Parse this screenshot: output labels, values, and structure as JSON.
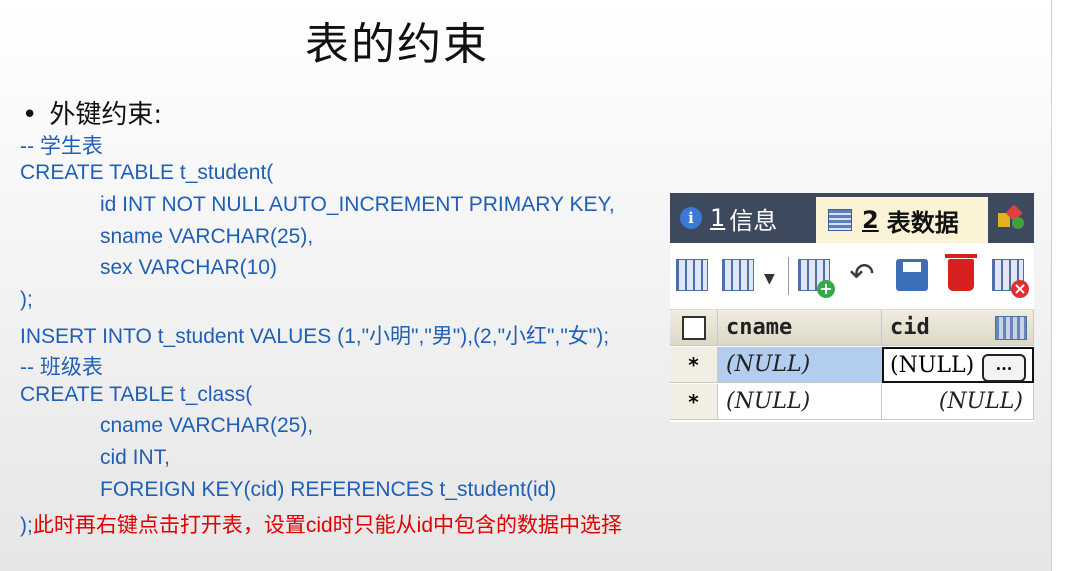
{
  "slide": {
    "title": "表的约束",
    "bullet": "外键约束:",
    "code_lines": [
      "-- 学生表",
      "CREATE TABLE t_student(",
      "id INT NOT NULL AUTO_INCREMENT PRIMARY KEY,",
      "sname VARCHAR(25),",
      "sex VARCHAR(10)",
      ");",
      "INSERT INTO t_student VALUES (1,\"小明\",\"男\"),(2,\"小红\",\"女\");",
      "-- 班级表",
      "CREATE TABLE t_class(",
      "cname VARCHAR(25),",
      "cid INT,",
      "FOREIGN KEY(cid) REFERENCES t_student(id)",
      ");"
    ],
    "note": "此时再右键点击打开表，设置cid时只能从id中包含的数据中选择"
  },
  "db_panel": {
    "tabs": [
      {
        "num": "1",
        "label": "信息"
      },
      {
        "num": "2",
        "label": "表数据"
      }
    ],
    "toolbar_icons": [
      "grid-import-icon",
      "grid-dropdown-icon",
      "add-row-icon",
      "undo-icon",
      "save-icon",
      "delete-icon",
      "cancel-icon"
    ],
    "columns": [
      "cname",
      "cid"
    ],
    "rows": [
      {
        "marker": "*",
        "cname": "(NULL)",
        "cid": "(NULL)",
        "ellipsis": "..."
      },
      {
        "marker": "*",
        "cname": "(NULL)",
        "cid": "(NULL)"
      }
    ]
  }
}
